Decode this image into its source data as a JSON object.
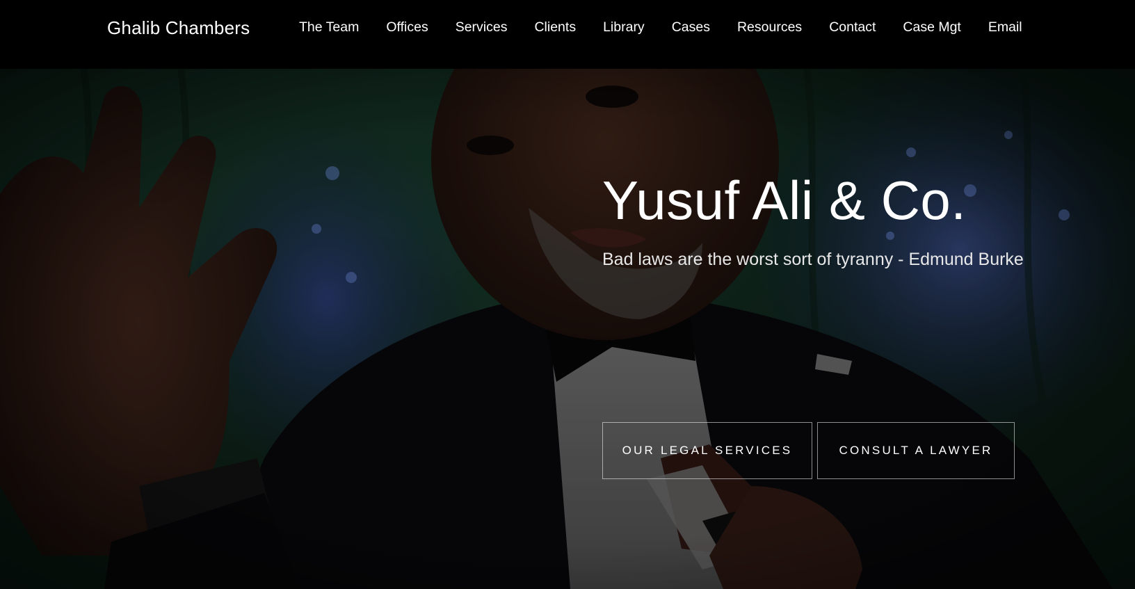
{
  "navbar": {
    "brand": "Ghalib Chambers",
    "links": [
      {
        "label": "The Team"
      },
      {
        "label": "Offices"
      },
      {
        "label": "Services"
      },
      {
        "label": "Clients"
      },
      {
        "label": "Library"
      },
      {
        "label": "Cases"
      },
      {
        "label": "Resources"
      },
      {
        "label": "Contact"
      },
      {
        "label": "Case Mgt"
      },
      {
        "label": "Email"
      }
    ]
  },
  "hero": {
    "title": "Yusuf Ali & Co.",
    "quote": "Bad laws are the worst sort of tyranny - Edmund Burke",
    "buttons": {
      "services_label": "Our Legal Services",
      "consult_label": "Consult a Lawyer"
    },
    "background": {
      "subject": "photo of a man in a black tuxedo holding a microphone, raising his left hand",
      "colors": {
        "backdrop_green": "#0f2a1e",
        "backdrop_blue": "#1f2a5a",
        "suit": "#0a0a0c",
        "skin": "#2a1812",
        "shirt": "#bfbfbf"
      }
    }
  }
}
